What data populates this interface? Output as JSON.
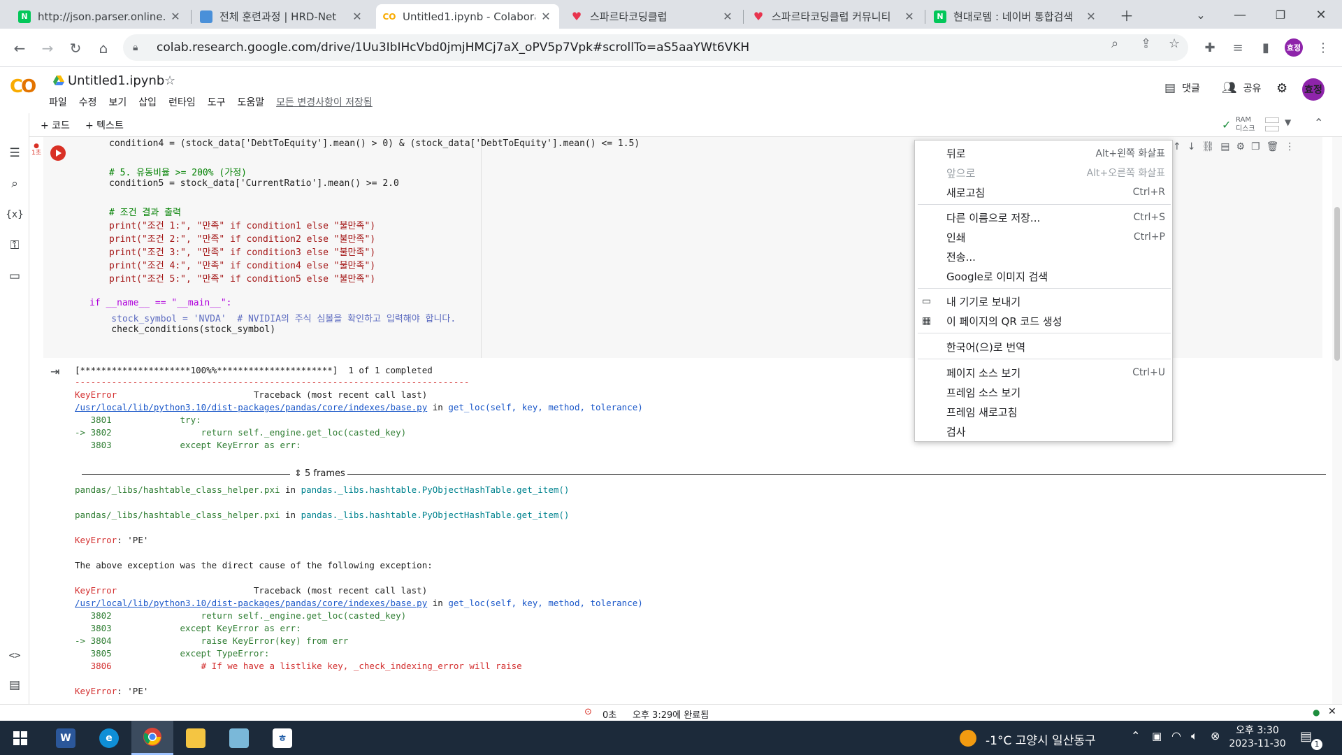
{
  "browser": {
    "tabs": [
      {
        "title": "http://json.parser.online.fr",
        "favicon": "naver-n-icon",
        "fav_color": "#03c75a",
        "fav_text": "N"
      },
      {
        "title": "전체 훈련과정 | HRD-Net",
        "favicon": "hrdnet-icon",
        "fav_color": "#4a90d9",
        "fav_text": ""
      },
      {
        "title": "Untitled1.ipynb - Colabora",
        "favicon": "colab-icon",
        "fav_color": "#f9ab00",
        "fav_text": "CO"
      },
      {
        "title": "스파르타코딩클럽",
        "favicon": "sparta-heart-icon",
        "fav_color": "#e8344e",
        "fav_text": ""
      },
      {
        "title": "스파르타코딩클럽 커뮤니티",
        "favicon": "sparta-heart-icon",
        "fav_color": "#e8344e",
        "fav_text": ""
      },
      {
        "title": "현대로템 : 네이버 통합검색",
        "favicon": "naver-n-icon",
        "fav_color": "#03c75a",
        "fav_text": "N"
      }
    ],
    "url": "colab.research.google.com/drive/1Uu3IbIHcVbd0jmjHMCj7aX_oPV5p7Vpk#scrollTo=aS5aaYWt6VKH"
  },
  "colab": {
    "title": "Untitled1.ipynb",
    "menu": [
      "파일",
      "수정",
      "보기",
      "삽입",
      "런타임",
      "도구",
      "도움말"
    ],
    "saved_status": "모든 변경사항이 저장됨",
    "comment_label": "댓글",
    "share_label": "공유",
    "user_initials": "효정",
    "add_code": "+ 코드",
    "add_text": "+ 텍스트",
    "ram_label": "RAM",
    "disk_label": "디스크",
    "cell_exec_count": "1초"
  },
  "code": {
    "l1": "condition4 = (stock_data['DebtToEquity'].mean() > 0) & (stock_data['DebtToEquity'].mean() <= 1.5)",
    "l2": "# 5. 유동비율 >= 200% (가정)",
    "l3": "condition5 = stock_data['CurrentRatio'].mean() >= 2.0",
    "l4": "# 조건 결과 출력",
    "l5": "print(\"조건 1:\", \"만족\" if condition1 else \"불만족\")",
    "l6": "print(\"조건 2:\", \"만족\" if condition2 else \"불만족\")",
    "l7": "print(\"조건 3:\", \"만족\" if condition3 else \"불만족\")",
    "l8": "print(\"조건 4:\", \"만족\" if condition4 else \"불만족\")",
    "l9": "print(\"조건 5:\", \"만족\" if condition5 else \"불만족\")",
    "l10": "if __name__ == \"__main__\":",
    "l11": "    stock_symbol = 'NVDA'  # NVIDIA의 주식 심볼을 확인하고 입력해야 합니다.",
    "l12": "    check_conditions(stock_symbol)"
  },
  "output": {
    "progress": "[*********************100%%**********************]  1 of 1 completed",
    "dash": "---------------------------------------------------------------------------",
    "tb1_head_a": "KeyError",
    "tb1_head_b": "                          Traceback (most recent call last)",
    "tb1_path": "/usr/local/lib/python3.10/dist-packages/pandas/core/indexes/base.py",
    "tb1_in": " in ",
    "tb1_func": "get_loc(self, key, method, tolerance)",
    "tb1_l1": "   3801             try:",
    "tb1_l2": "-> 3802                 return self._engine.get_loc(casted_key)",
    "tb1_l3": "   3803             except KeyError as err:",
    "frames_label": "5 frames",
    "hash1_a": "pandas/_libs/hashtable_class_helper.pxi",
    "hash1_b": " in ",
    "hash1_c": "pandas._libs.hashtable.PyObjectHashTable.get_item()",
    "hash2_a": "pandas/_libs/hashtable_class_helper.pxi",
    "hash2_b": " in ",
    "hash2_c": "pandas._libs.hashtable.PyObjectHashTable.get_item()",
    "ke1_a": "KeyError",
    "ke1_b": ": 'PE'",
    "cause": "The above exception was the direct cause of the following exception:",
    "tb2_head_a": "KeyError",
    "tb2_head_b": "                          Traceback (most recent call last)",
    "tb2_path": "/usr/local/lib/python3.10/dist-packages/pandas/core/indexes/base.py",
    "tb2_in": " in ",
    "tb2_func": "get_loc(self, key, method, tolerance)",
    "tb2_l1": "   3802                 return self._engine.get_loc(casted_key)",
    "tb2_l2": "   3803             except KeyError as err:",
    "tb2_l3": "-> 3804                 raise KeyError(key) from err",
    "tb2_l4": "   3805             except TypeError:",
    "tb2_l5": "   3806                 # If we have a listlike key, _check_indexing_error will raise",
    "ke2_a": "KeyError",
    "ke2_b": ": 'PE'"
  },
  "context_menu": {
    "back": "뒤로",
    "back_sc": "Alt+왼쪽 화살표",
    "forward": "앞으로",
    "forward_sc": "Alt+오른쪽 화살표",
    "reload": "새로고침",
    "reload_sc": "Ctrl+R",
    "save_as": "다른 이름으로 저장...",
    "save_as_sc": "Ctrl+S",
    "print": "인쇄",
    "print_sc": "Ctrl+P",
    "cast": "전송...",
    "google_image": "Google로 이미지 검색",
    "send_device": "내 기기로 보내기",
    "qr": "이 페이지의 QR 코드 생성",
    "translate": "한국어(으)로 번역",
    "view_source": "페이지 소스 보기",
    "view_source_sc": "Ctrl+U",
    "frame_source": "프레임 소스 보기",
    "frame_reload": "프레임 새로고침",
    "inspect": "검사"
  },
  "status": {
    "elapsed": "0초",
    "completed": "오후 3:29에 완료됨"
  },
  "taskbar": {
    "weather": "-1°C  고양시 일산동구",
    "time": "오후 3:30",
    "date": "2023-11-30",
    "notifications": "1"
  }
}
